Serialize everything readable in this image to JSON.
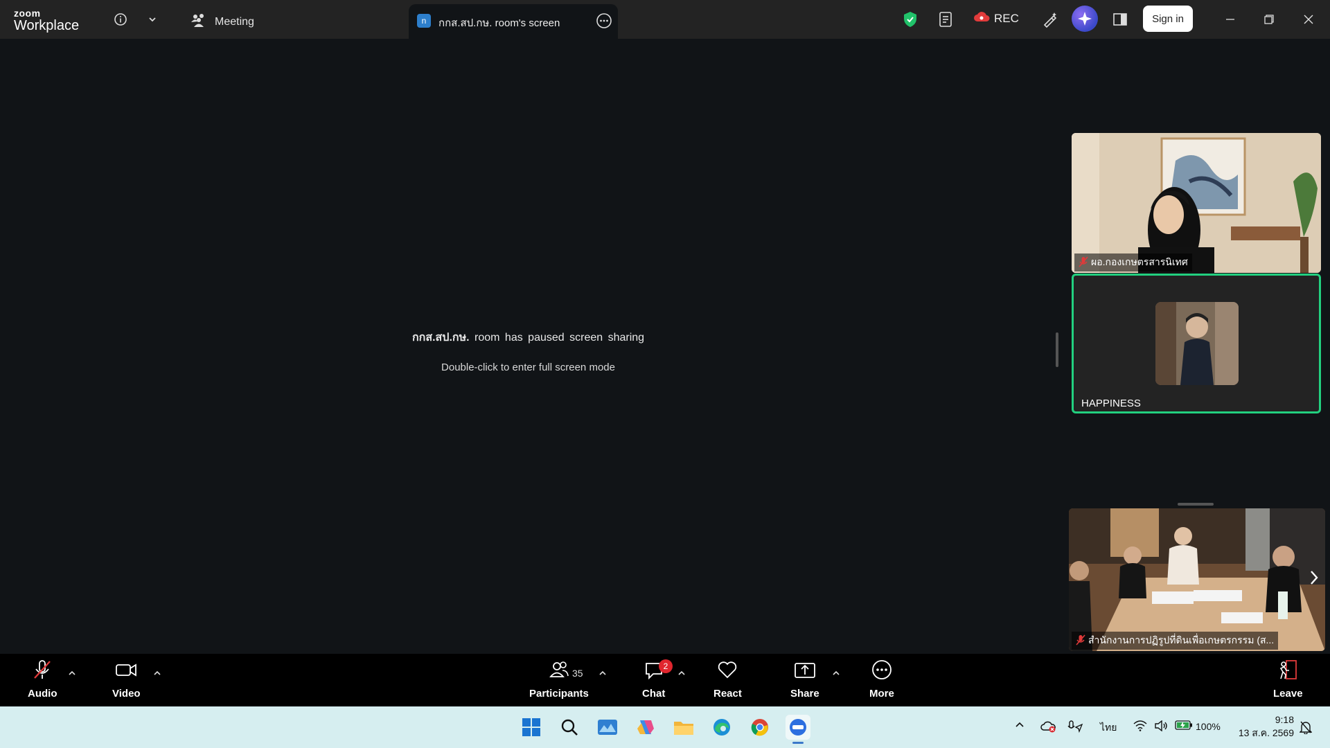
{
  "titlebar": {
    "brand_top": "zoom",
    "brand_bottom": "Workplace",
    "meeting_label": "Meeting",
    "tab_badge": "n",
    "tab_title": "กกส.สป.กษ. room's screen",
    "rec_label": "REC",
    "signin_label": "Sign in"
  },
  "stage": {
    "pause_name": "กกส.สป.กษ.",
    "pause_text": "room has paused screen sharing",
    "hint": "Double-click to enter full screen mode"
  },
  "tiles": [
    {
      "name": "ผอ.กองเกษตรสารนิเทศ",
      "muted": true
    },
    {
      "name": "HAPPINESS",
      "muted": false,
      "active_speaker": true
    },
    {
      "name": "สำนักงานการปฏิรูปที่ดินเพื่อเกษตรกรรม (ส...",
      "muted": true
    }
  ],
  "toolbar": {
    "audio": "Audio",
    "video": "Video",
    "participants": "Participants",
    "participants_count": "35",
    "chat": "Chat",
    "chat_badge": "2",
    "react": "React",
    "share": "Share",
    "more": "More",
    "leave": "Leave"
  },
  "taskbar": {
    "language": "ไทย",
    "battery": "100%",
    "time": "9:18",
    "date": "13 ส.ค. 2569"
  },
  "colors": {
    "active_speaker_border": "#22d07f",
    "chat_badge": "#e0262e",
    "rec_cloud": "#e13b3b",
    "leave_icon": "#e13b3b",
    "shield": "#21c26a"
  }
}
